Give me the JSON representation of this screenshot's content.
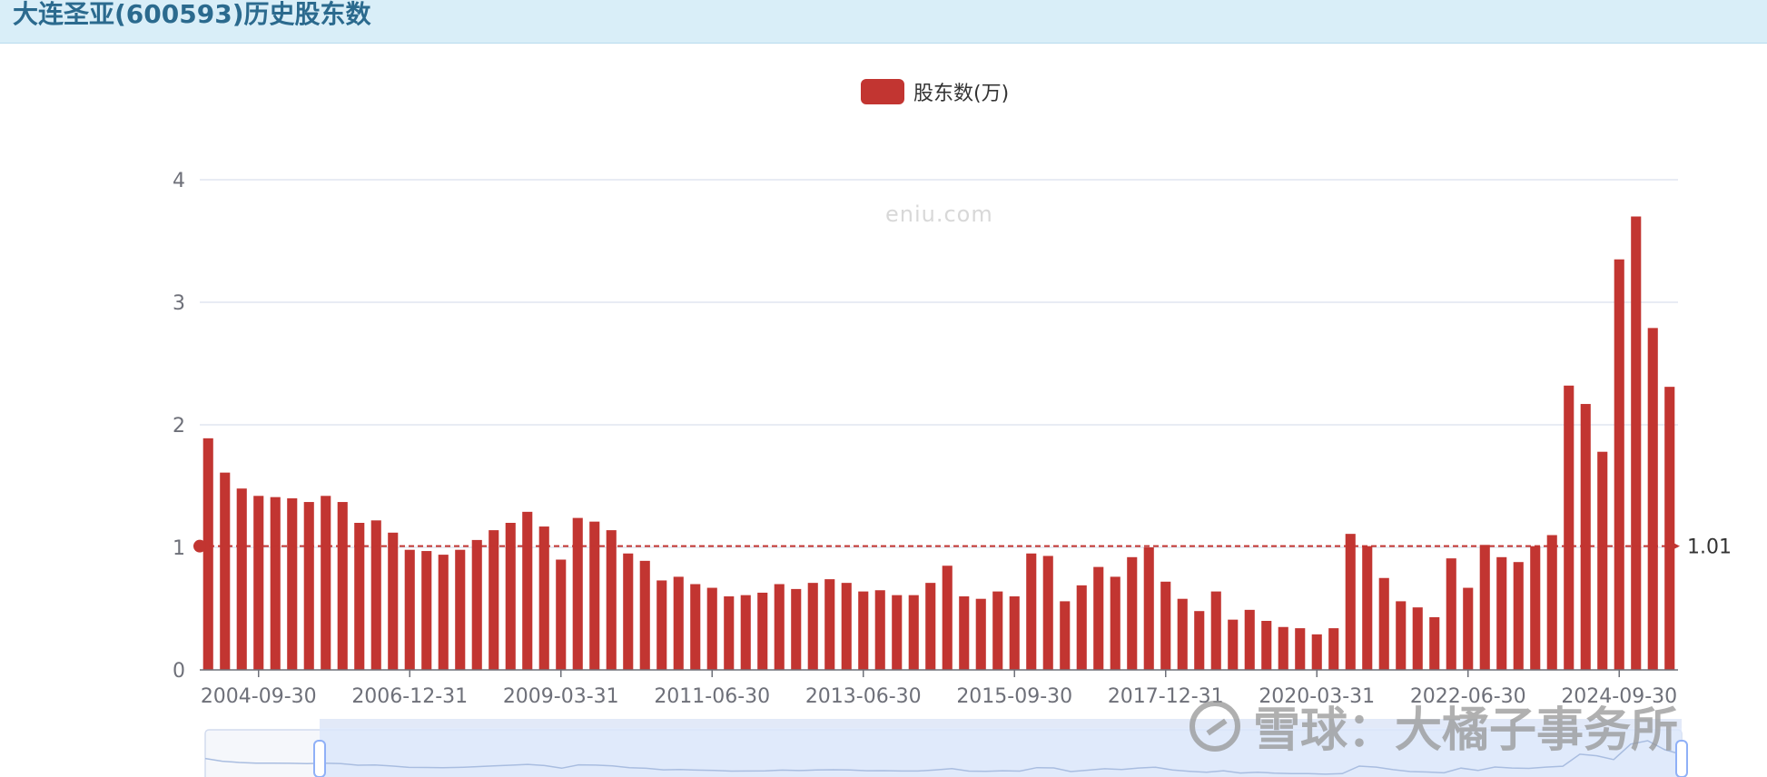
{
  "header": {
    "title": "大连圣亚(600593)历史股东数"
  },
  "watermark": "eniu.com",
  "corner_watermark": "雪球：大橘子事务所",
  "colors": {
    "bar": "#c23531",
    "grid": "#e0e6f1",
    "axis": "#6e7079",
    "header_bg": "#d9eef8",
    "slider": "#dbe6fb"
  },
  "chart_data": {
    "type": "bar",
    "legend": [
      "股东数(万)"
    ],
    "ylim": [
      0,
      4
    ],
    "yticks": [
      0,
      1,
      2,
      3,
      4
    ],
    "x_tick_labels": [
      "2004-09-30",
      "2006-12-31",
      "2009-03-31",
      "2011-06-30",
      "2013-06-30",
      "2015-09-30",
      "2017-12-31",
      "2020-03-31",
      "2022-06-30",
      "2024-09-30"
    ],
    "x_tick_indices": [
      3,
      12,
      21,
      30,
      39,
      48,
      57,
      66,
      75,
      84
    ],
    "mean_line": {
      "value": 1.01,
      "label": "1.01"
    },
    "grid": true,
    "series": [
      {
        "name": "股东数(万)",
        "values": [
          1.89,
          1.61,
          1.48,
          1.42,
          1.41,
          1.4,
          1.37,
          1.42,
          1.37,
          1.2,
          1.22,
          1.12,
          0.98,
          0.97,
          0.94,
          0.98,
          1.06,
          1.14,
          1.2,
          1.29,
          1.17,
          0.9,
          1.24,
          1.21,
          1.14,
          0.95,
          0.89,
          0.73,
          0.76,
          0.7,
          0.67,
          0.6,
          0.61,
          0.63,
          0.7,
          0.66,
          0.71,
          0.74,
          0.71,
          0.64,
          0.65,
          0.61,
          0.61,
          0.71,
          0.85,
          0.6,
          0.58,
          0.64,
          0.6,
          0.95,
          0.93,
          0.56,
          0.69,
          0.84,
          0.76,
          0.92,
          1.0,
          0.72,
          0.58,
          0.48,
          0.64,
          0.41,
          0.49,
          0.4,
          0.35,
          0.34,
          0.29,
          0.34,
          1.11,
          1.01,
          0.75,
          0.56,
          0.51,
          0.43,
          0.91,
          0.67,
          1.02,
          0.92,
          0.88,
          1.01,
          1.1,
          2.32,
          2.17,
          1.78,
          3.35,
          3.7,
          2.79,
          2.31
        ]
      }
    ]
  }
}
